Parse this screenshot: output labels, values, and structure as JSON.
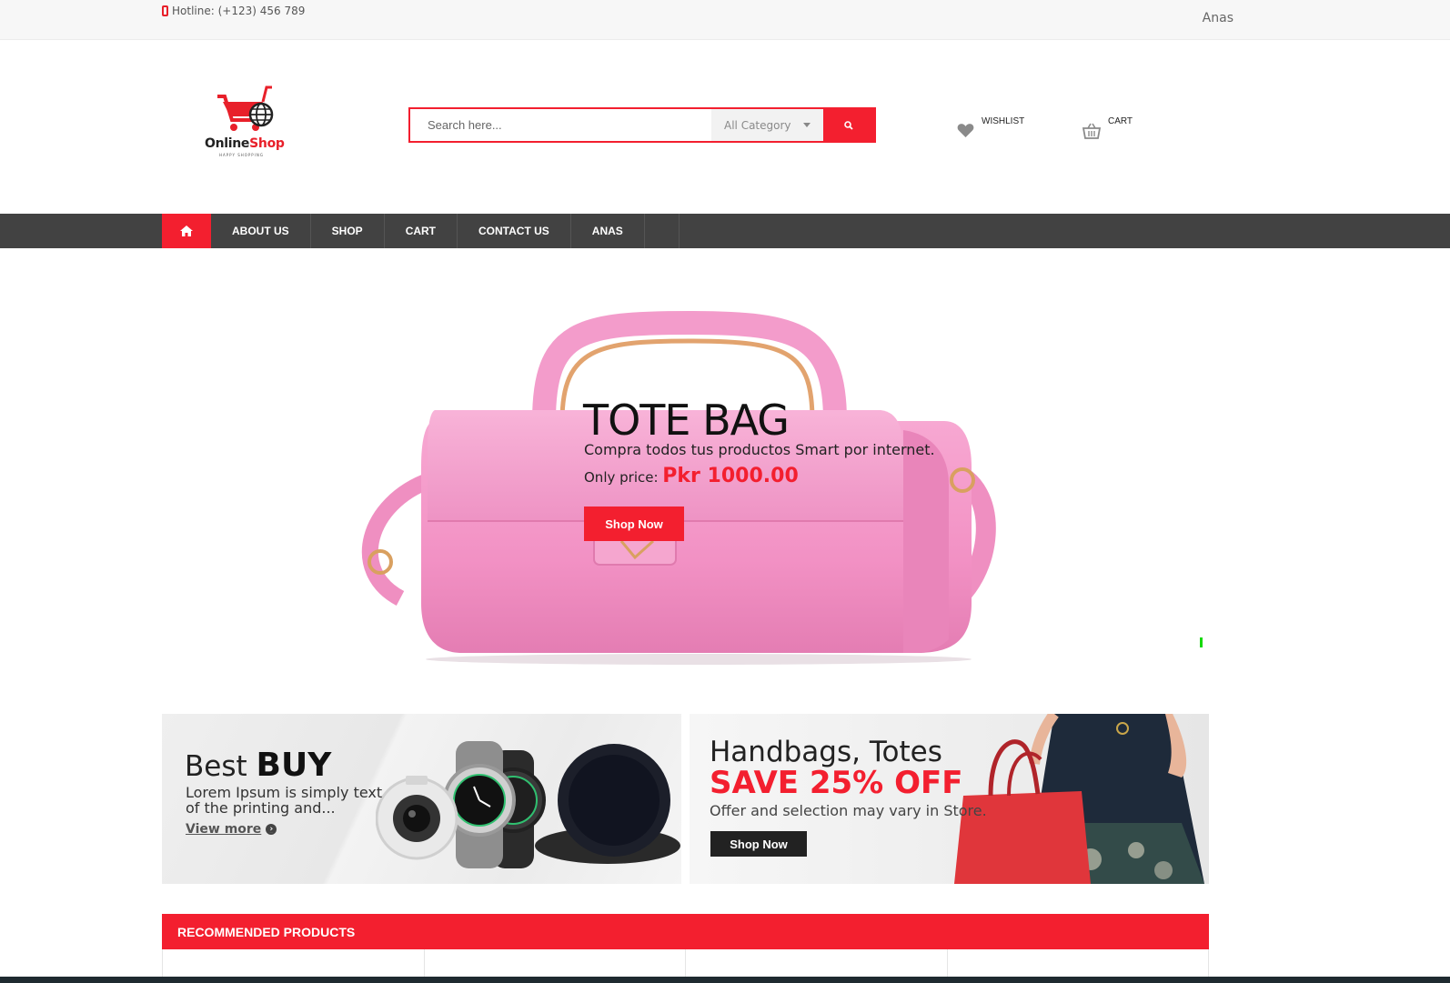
{
  "topbar": {
    "hotline": "Hotline: (+123) 456 789",
    "user": "Anas"
  },
  "logo": {
    "name_part1": "Online",
    "name_part2": "Shop",
    "tagline": "HAPPY SHOPPING"
  },
  "search": {
    "placeholder": "Search here...",
    "category": "All Category"
  },
  "header_links": {
    "wishlist": "WISHLIST",
    "cart": "CART"
  },
  "nav": {
    "items": [
      "ABOUT US",
      "SHOP",
      "CART",
      "CONTACT US",
      "ANAS"
    ]
  },
  "hero": {
    "title": "TOTE BAG",
    "subtitle": "Compra todos tus productos Smart por internet.",
    "price_label": "Only price:",
    "price": "Pkr 1000.00",
    "button": "Shop Now"
  },
  "banner_left": {
    "title_light": "Best",
    "title_bold": "BUY",
    "description": "Lorem Ipsum is simply text of the printing and...",
    "link": "View more"
  },
  "banner_right": {
    "title": "Handbags, Totes",
    "sale": "SAVE 25% OFF",
    "description": "Offer and selection may vary in Store.",
    "button": "Shop Now"
  },
  "recommended": {
    "title": "RECOMMENDED PRODUCTS"
  },
  "colors": {
    "accent": "#f31f2f",
    "nav_bg": "#424242"
  }
}
